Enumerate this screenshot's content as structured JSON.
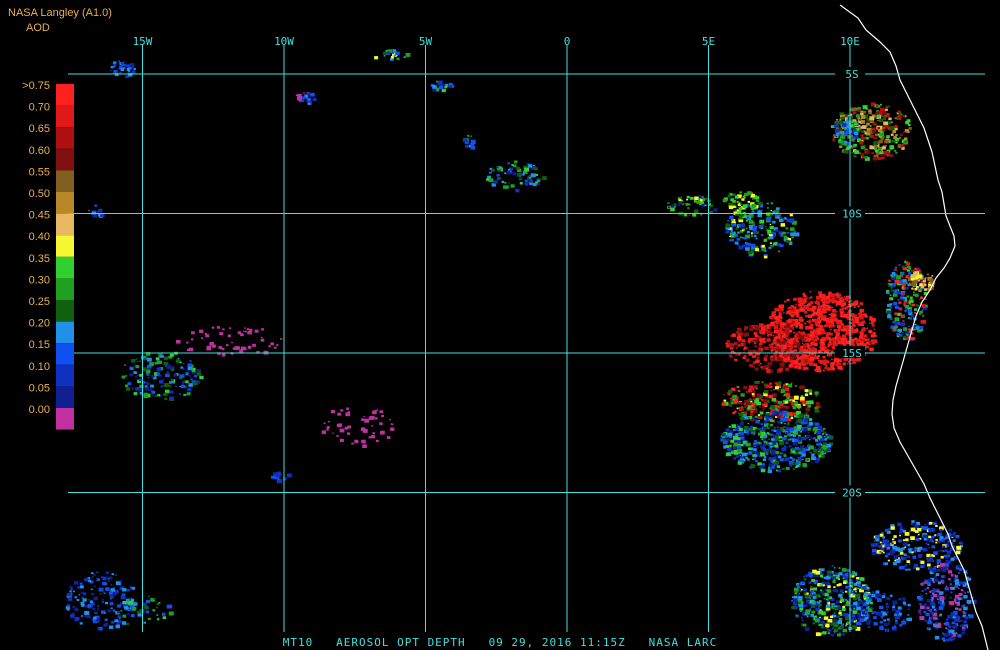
{
  "header": {
    "source": "NASA Langley (A1.0)",
    "product": "AOD"
  },
  "map": {
    "grid_color": "#40e0e0",
    "coast_color": "#ffffff",
    "longitudes": [
      {
        "label": "15W",
        "deg": -15
      },
      {
        "label": "10W",
        "deg": -10
      },
      {
        "label": "5W",
        "deg": -5
      },
      {
        "label": "0",
        "deg": 0
      },
      {
        "label": "5E",
        "deg": 5
      },
      {
        "label": "10E",
        "deg": 10
      }
    ],
    "latitudes": [
      {
        "label": "5S",
        "deg": -5
      },
      {
        "label": "10S",
        "deg": -10
      },
      {
        "label": "15S",
        "deg": -15
      },
      {
        "label": "20S",
        "deg": -20
      }
    ]
  },
  "legend": {
    "labels": [
      ">0.75",
      "0.70",
      "0.65",
      "0.60",
      "0.55",
      "0.50",
      "0.45",
      "0.40",
      "0.35",
      "0.30",
      "0.25",
      "0.20",
      "0.15",
      "0.10",
      "0.05",
      "0.00"
    ],
    "colors": [
      "#ff2020",
      "#e01818",
      "#b01010",
      "#801010",
      "#806020",
      "#b88828",
      "#e8b860",
      "#f8f830",
      "#30d030",
      "#20a020",
      "#106010",
      "#2090e8",
      "#1050f0",
      "#1030c0",
      "#102090",
      "#c030a0"
    ]
  },
  "footer": {
    "parts": [
      "MT10",
      "AEROSOL OPT DEPTH",
      "09 29, 2016 11:15Z",
      "NASA LARC"
    ]
  }
}
